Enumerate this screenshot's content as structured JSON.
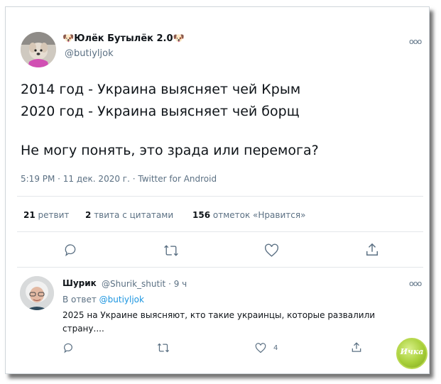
{
  "tweet": {
    "author_name": "Юлёк Бутылёк 2.0",
    "author_handle": "@butiyljok",
    "more_glyph": "ooo",
    "lines": [
      "2014 год - Украина выясняет чей Крым",
      "2020 год - Украина выясняет чей борщ",
      "Не могу понять, это зрада или перемога?"
    ],
    "meta": "5:19 PM · 11 дек. 2020 г. · Twitter for Android",
    "stats": {
      "retweets_count": "21",
      "retweets_label": "ретвит",
      "quotes_count": "2",
      "quotes_label": "твита с цитатами",
      "likes_count": "156",
      "likes_label": "отметок «Нравится»"
    }
  },
  "reply": {
    "author_name": "Шурик",
    "author_handle_time": "@Shurik_shutit · 9 ч",
    "more_glyph": "ooo",
    "reply_to_prefix": "В ответ ",
    "reply_to_handle": "@butiyljok",
    "text_lines": [
      "2025 на Украине выясняют, кто такие украинцы, которые развалили",
      "страну...."
    ],
    "like_count": "4"
  },
  "watermark": {
    "text": "Ичка"
  },
  "icons": {
    "reply": "reply-icon",
    "retweet": "retweet-icon",
    "like": "heart-icon",
    "share": "share-icon"
  },
  "colors": {
    "link": "#1b95e0",
    "secondary": "#5b7083",
    "text": "#0f1419",
    "watermark": "#a7cf38"
  }
}
